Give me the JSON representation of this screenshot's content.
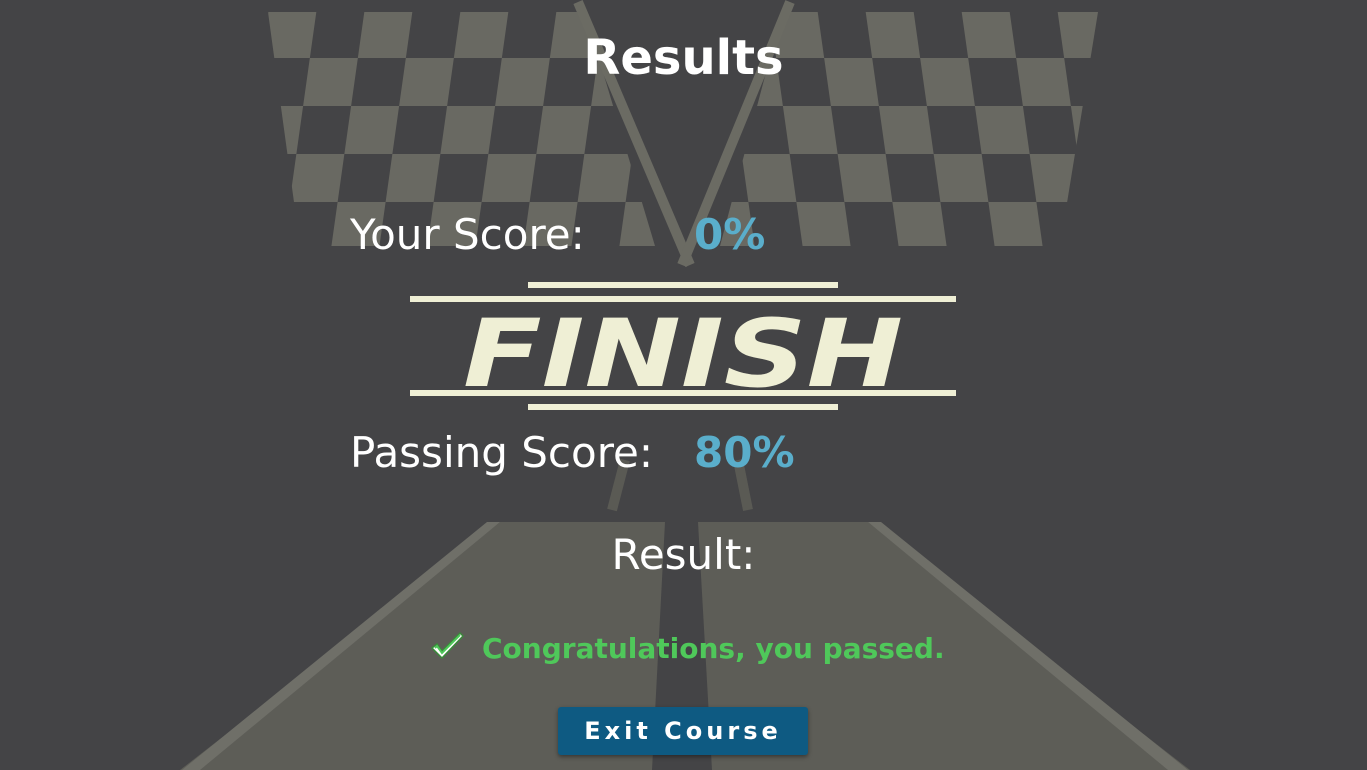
{
  "page": {
    "title": "Results",
    "banner_text": "FINISH"
  },
  "score": {
    "your_label": "Your Score:",
    "your_value": "0%",
    "passing_label": "Passing Score:",
    "passing_value": "80%"
  },
  "result": {
    "label": "Result:",
    "message": "Congratulations, you passed.",
    "status_icon": "checkmark-icon"
  },
  "actions": {
    "exit_label": "Exit Course"
  },
  "colors": {
    "background": "#444446",
    "accent_value": "#5aaecb",
    "success": "#4fc85a",
    "button": "#0e5a82",
    "banner": "#efefd5"
  }
}
